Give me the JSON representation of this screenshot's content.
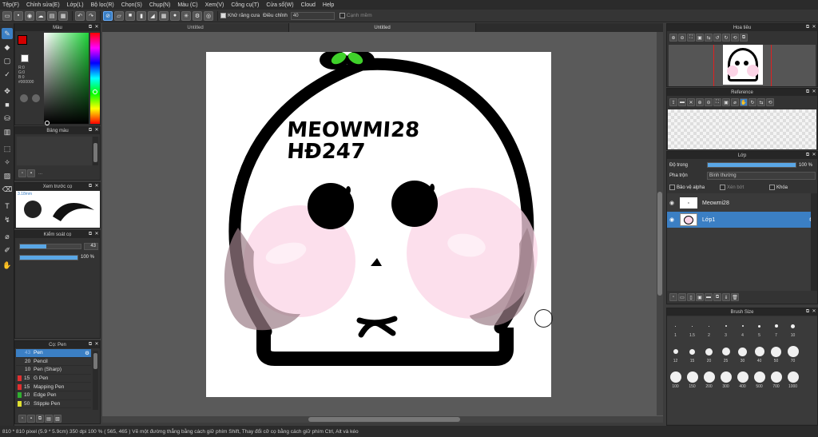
{
  "menu": [
    "Tệp(F)",
    "Chỉnh sửa(E)",
    "Lớp(L)",
    "Bộ lọc(R)",
    "Chọn(S)",
    "Chụp(N)",
    "Màu (C)",
    "Xem(V)",
    "Công cụ(T)",
    "Cửa sổ(W)",
    "Cloud",
    "Help"
  ],
  "toolbar": {
    "antialias_label": "Khử răng cưa",
    "adjust_label": "Điều chỉnh",
    "adjust_value": "40",
    "edge_label": "Cạnh mềm"
  },
  "tabs": [
    "Untitled",
    "Untitled"
  ],
  "color_panel": {
    "title": "Màu",
    "r": "R:0",
    "g": "G:0",
    "b": "B:0",
    "hex": "#000000",
    "primary_color": "#d40000",
    "secondary_color": "#ffffff"
  },
  "swatch_panel": {
    "title": "Bảng màu",
    "more": "..."
  },
  "brush_preview": {
    "title": "Xem trước cọ",
    "size": "3.18mm"
  },
  "brush_control": {
    "title": "Kiểm soát cọ",
    "size_value": "43",
    "opacity_value": "100 %",
    "size_fraction": 0.43,
    "opacity_fraction": 1.0
  },
  "pen_panel": {
    "title": "Cọ: Pen",
    "items": [
      {
        "num": "43",
        "name": "Pen",
        "color": "#2a6ab0",
        "selected": true
      },
      {
        "num": "20",
        "name": "Pencil",
        "color": "#333333"
      },
      {
        "num": "10",
        "name": "Pen (Sharp)",
        "color": "#333333"
      },
      {
        "num": "15",
        "name": "G Pen",
        "color": "#e03030"
      },
      {
        "num": "15",
        "name": "Mapping Pen",
        "color": "#e03030"
      },
      {
        "num": "10",
        "name": "Edge Pen",
        "color": "#30b030"
      },
      {
        "num": "50",
        "name": "Stipple Pen",
        "color": "#e0e030"
      }
    ]
  },
  "artwork": {
    "line1": "MEOWMI28",
    "line2": "HĐ247"
  },
  "navigator": {
    "title": "Hoa tiêu"
  },
  "reference": {
    "title": "Reference"
  },
  "layer_panel": {
    "title": "Lớp",
    "opacity_label": "Độ trong",
    "opacity_value": "100 %",
    "opacity_fraction": 1.0,
    "blend_label": "Pha trộn",
    "blend_value": "Bình thường",
    "protect_alpha": "Bảo vệ alpha",
    "clipping": "Xén bớt",
    "lock": "Khóa",
    "layers": [
      {
        "name": "Meowmi28",
        "selected": false
      },
      {
        "name": "Lớp1",
        "selected": true
      }
    ]
  },
  "brush_size": {
    "title": "Brush Size",
    "labels": [
      "1",
      "1.5",
      "2",
      "3",
      "4",
      "5",
      "7",
      "10",
      "12",
      "15",
      "20",
      "25",
      "30",
      "40",
      "50",
      "70",
      "100",
      "150",
      "200",
      "300",
      "400",
      "500",
      "700",
      "1000"
    ]
  },
  "status": "810 * 810 pixel   (5.9 * 5.9cm)  350 dpi   100 %   ( 565, 465 )   Vẽ một đường thẳng bằng cách giữ phím Shift, Thay đổi cỡ cọ bằng cách giữ phím Ctrl, Alt và kéo"
}
